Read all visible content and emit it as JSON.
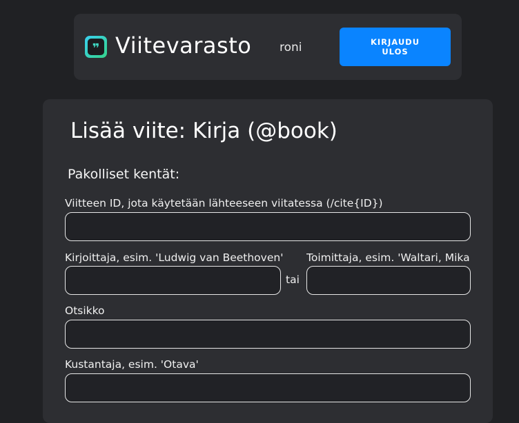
{
  "header": {
    "logo_icon": "quote-bubble-icon",
    "brand": "Viitevarasto",
    "username": "roni",
    "logout_label": "KIRJAUDU ULOS",
    "accent_color": "#0a84ff"
  },
  "form": {
    "title": "Lisää viite: Kirja (@book)",
    "section_required": "Pakolliset kentät:",
    "fields": {
      "id_label": "Viitteen ID, jota käytetään lähteeseen viitatessa (/cite{ID})",
      "id_value": "",
      "author_label": "Kirjoittaja, esim. 'Ludwig van Beethoven'",
      "author_value": "",
      "or_label": "tai",
      "editor_label": "Toimittaja, esim. 'Waltari, Mika",
      "editor_value": "",
      "title_label": "Otsikko",
      "title_value": "",
      "publisher_label": "Kustantaja, esim. 'Otava'",
      "publisher_value": ""
    }
  }
}
